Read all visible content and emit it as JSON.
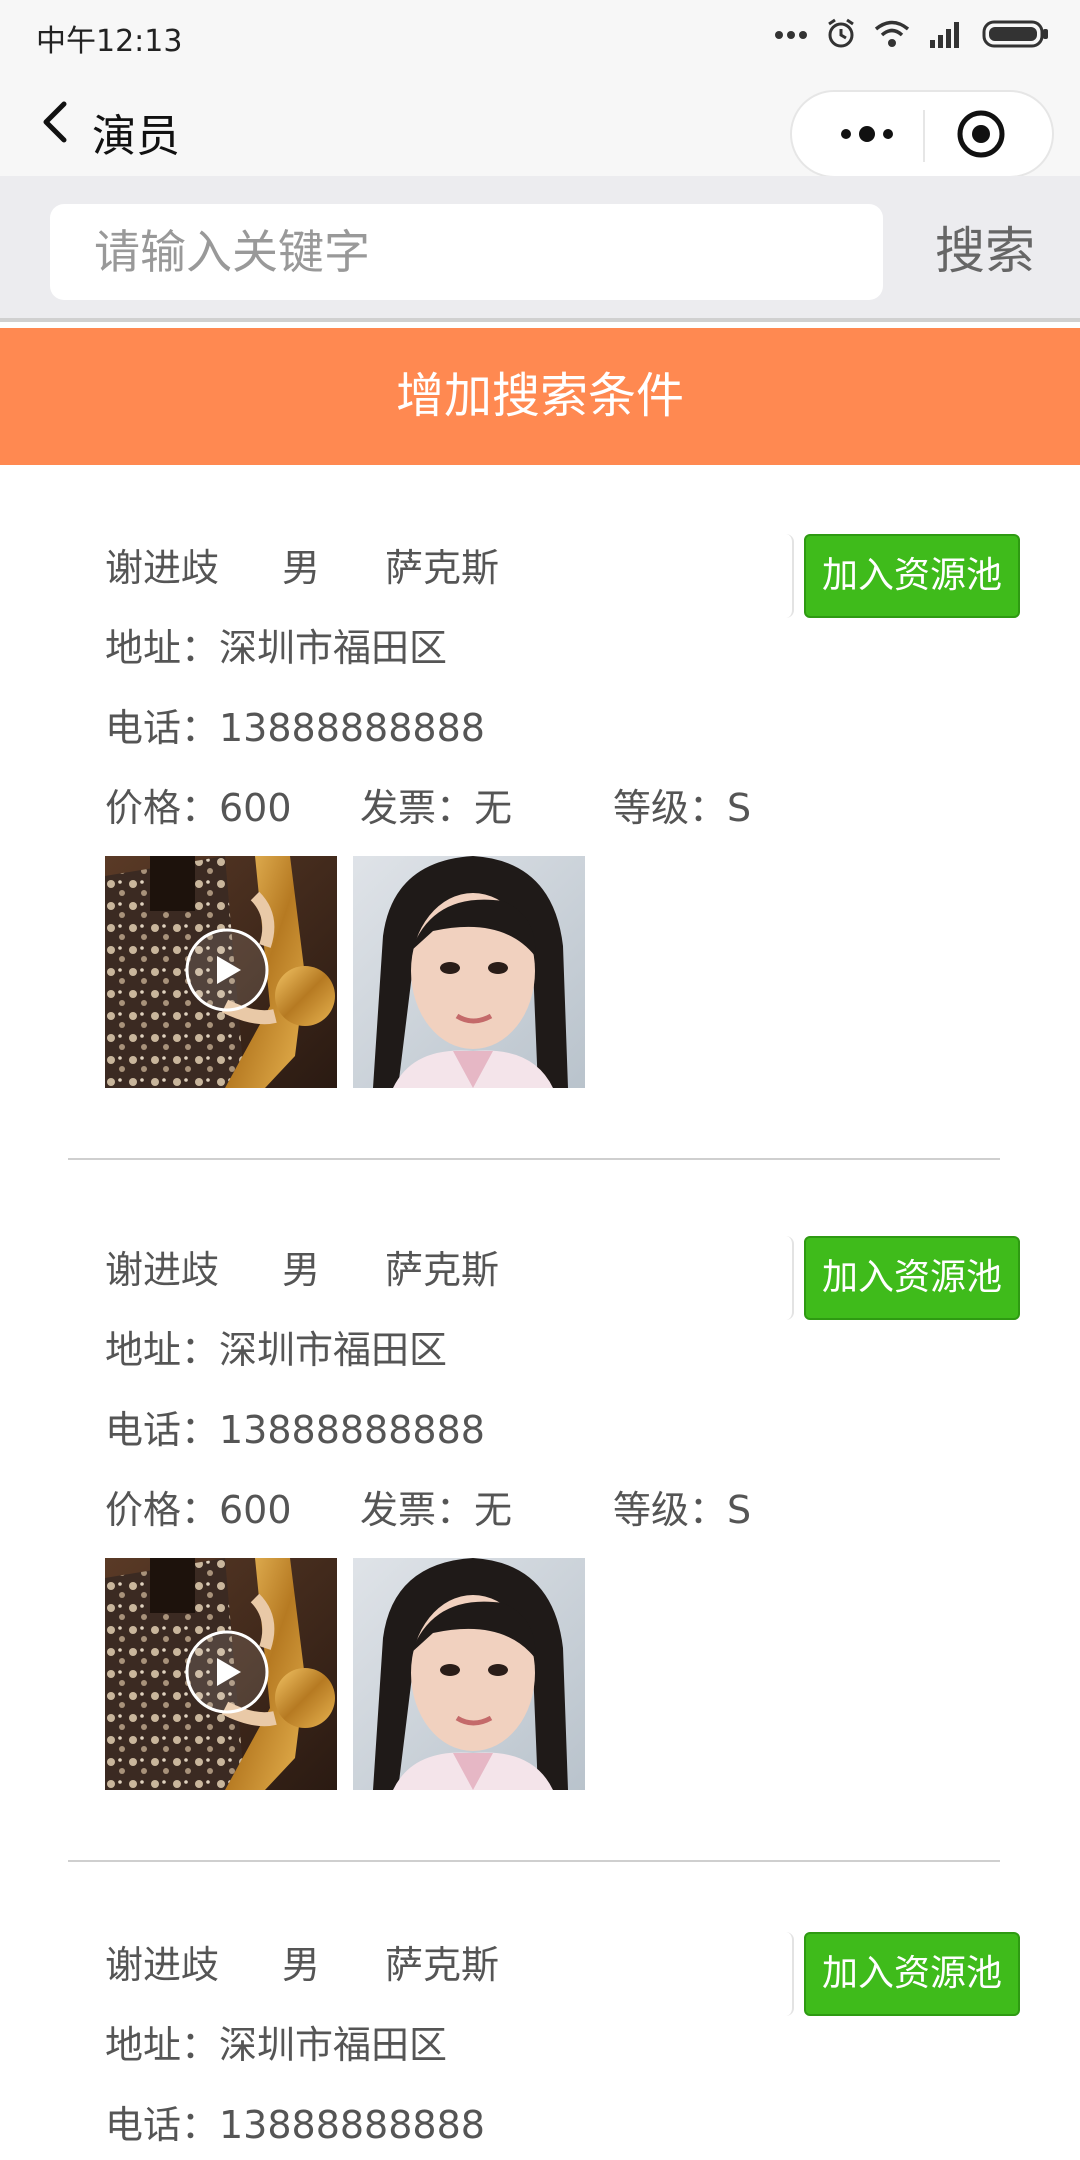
{
  "status_bar": {
    "time": "中午12:13"
  },
  "nav": {
    "title": "演员"
  },
  "search": {
    "placeholder": "请输入关键字",
    "button_label": "搜索"
  },
  "add_filter_label": "增加搜索条件",
  "cards": [
    {
      "name": "谢进歧",
      "gender": "男",
      "instrument": "萨克斯",
      "address": "地址：深圳市福田区",
      "phone": "电话：13888888888",
      "price": "价格：600",
      "invoice": "发票：无",
      "grade": "等级：S",
      "button_label": "加入资源池"
    },
    {
      "name": "谢进歧",
      "gender": "男",
      "instrument": "萨克斯",
      "address": "地址：深圳市福田区",
      "phone": "电话：13888888888",
      "price": "价格：600",
      "invoice": "发票：无",
      "grade": "等级：S",
      "button_label": "加入资源池"
    },
    {
      "name": "谢进歧",
      "gender": "男",
      "instrument": "萨克斯",
      "address": "地址：深圳市福田区",
      "phone": "电话：13888888888",
      "button_label": "加入资源池"
    }
  ],
  "colors": {
    "accent_orange": "#ff8951",
    "button_green": "#3fbb1b"
  }
}
